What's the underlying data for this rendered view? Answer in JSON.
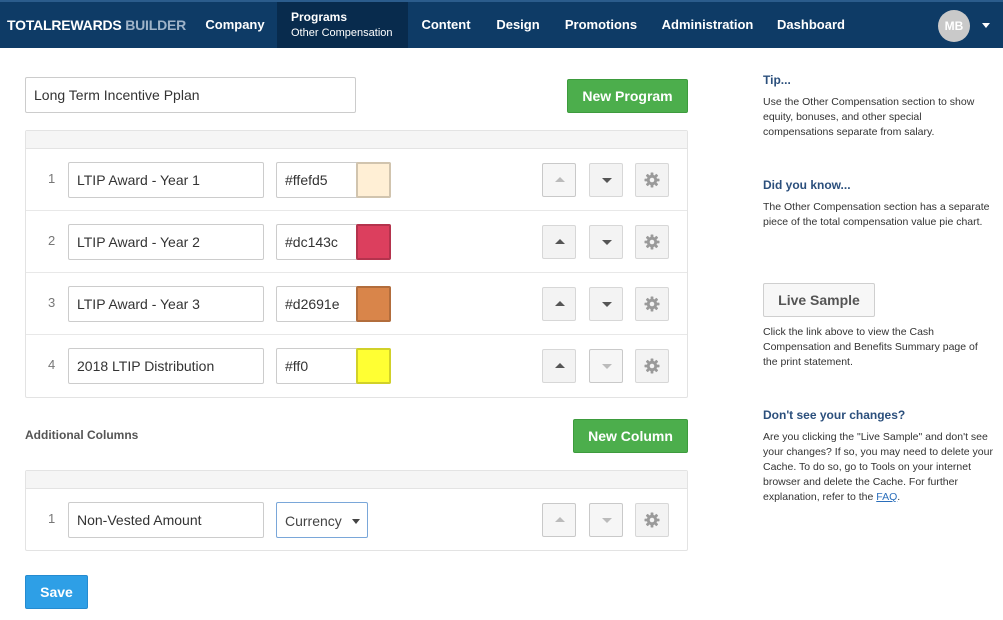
{
  "brand": {
    "part1": "TOTALREWARDS",
    "part2": "BUILDER"
  },
  "nav": {
    "company": "Company",
    "programs": "Programs",
    "programs_sub": "Other Compensation",
    "content": "Content",
    "design": "Design",
    "promotions": "Promotions",
    "administration": "Administration",
    "dashboard": "Dashboard",
    "avatar_initials": "MB"
  },
  "program": {
    "name_value": "Long Term Incentive Pplan",
    "new_program_label": "New Program"
  },
  "items": [
    {
      "num": "1",
      "name": "LTIP Award - Year 1",
      "color_text": "#ffefd5",
      "swatch": "#ffefd5"
    },
    {
      "num": "2",
      "name": "LTIP Award - Year 2",
      "color_text": "#dc143c",
      "swatch": "#dc3f5e"
    },
    {
      "num": "3",
      "name": "LTIP Award - Year 3",
      "color_text": "#d2691e",
      "swatch": "#d9854a"
    },
    {
      "num": "4",
      "name": "2018 LTIP Distribution",
      "color_text": "#ff0",
      "swatch": "#ffff33"
    }
  ],
  "additional": {
    "label": "Additional Columns",
    "new_column_label": "New Column",
    "columns": [
      {
        "num": "1",
        "name": "Non-Vested Amount",
        "type": "Currency"
      }
    ]
  },
  "save_label": "Save",
  "sidebar": {
    "tip_heading": "Tip...",
    "tip_text": "Use the Other Compensation section to show equity, bonuses, and other special compensations separate from salary.",
    "know_heading": "Did you know...",
    "know_text": "The Other Compensation section has a separate piece of the total compensation value pie chart.",
    "live_sample_label": "Live Sample",
    "live_text": "Click the link above to view the Cash Compensation and Benefits Summary page of the print statement.",
    "changes_heading": "Don't see your changes?",
    "changes_text": "Are you clicking the \"Live Sample\" and don't see your changes? If so, you may need to delete your Cache. To do so, go to Tools on your internet browser and delete the Cache. For further explanation, refer to the",
    "faq_link": "FAQ",
    "changes_end": "."
  }
}
